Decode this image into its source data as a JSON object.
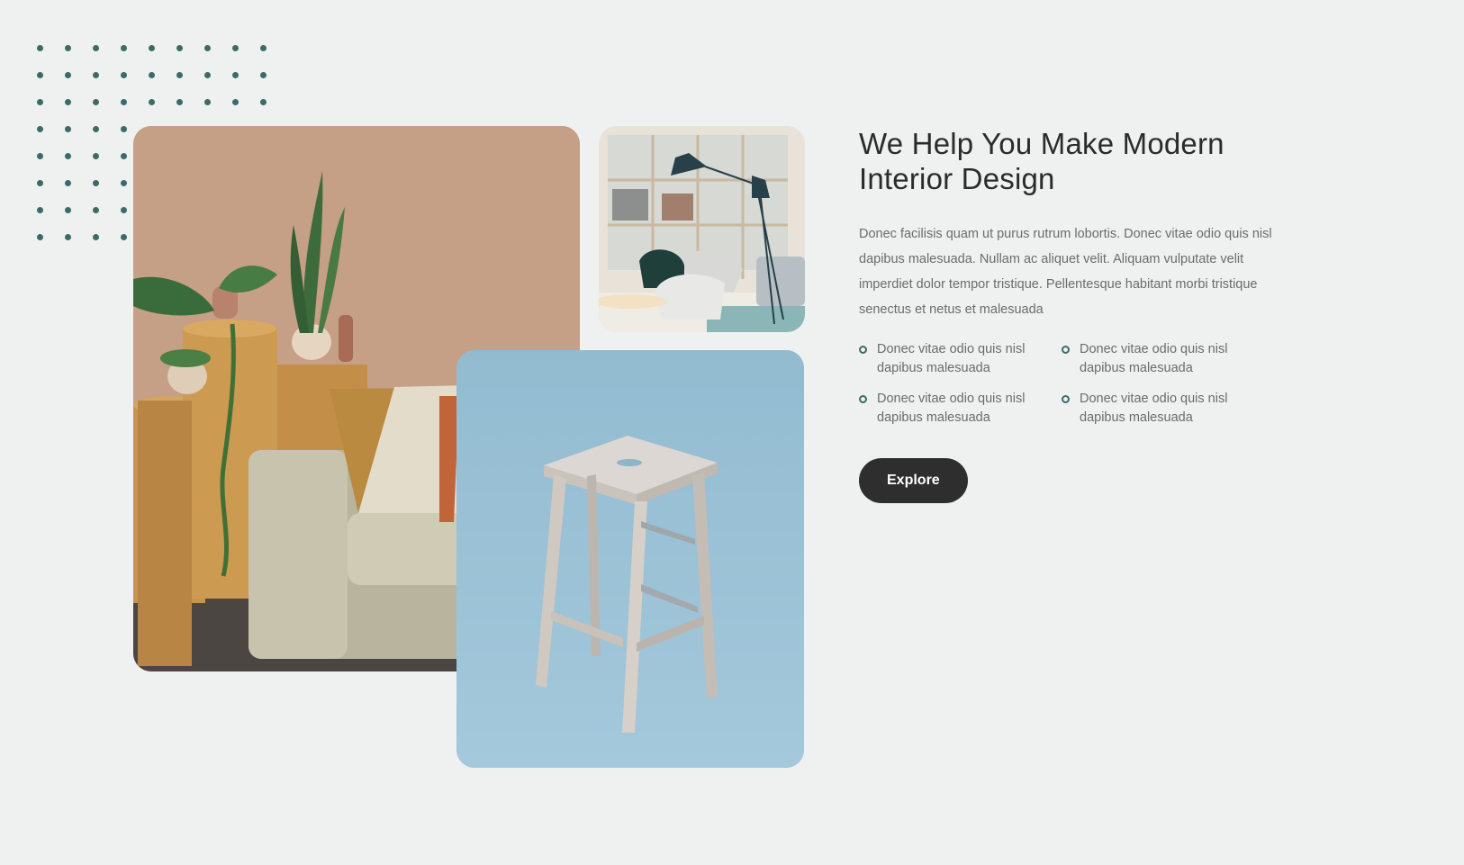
{
  "hero": {
    "title": "We Help You Make Modern Interior Design",
    "description": "Donec facilisis quam ut purus rutrum lobortis. Donec vitae odio quis nisl dapibus malesuada. Nullam ac aliquet velit. Aliquam vulputate velit imperdiet dolor tempor tristique. Pellentesque habitant morbi tristique senectus et netus et malesuada",
    "features": [
      {
        "text": "Donec vitae odio quis nisl dapibus malesuada"
      },
      {
        "text": "Donec vitae odio quis nisl dapibus malesuada"
      },
      {
        "text": "Donec vitae odio quis nisl dapibus malesuada"
      },
      {
        "text": "Donec vitae odio quis nisl dapibus malesuada"
      }
    ],
    "button_label": "Explore"
  },
  "images": {
    "sofa": "sofa-with-plants-photo",
    "lounge": "lounge-chairs-with-floor-lamp-photo",
    "stool": "wooden-bar-stool-photo"
  },
  "colors": {
    "background": "#eff1f0",
    "accent": "#3b6b67",
    "button": "#2e2e2e",
    "heading": "#2b2b2b",
    "body_text": "#6b6b6b"
  }
}
